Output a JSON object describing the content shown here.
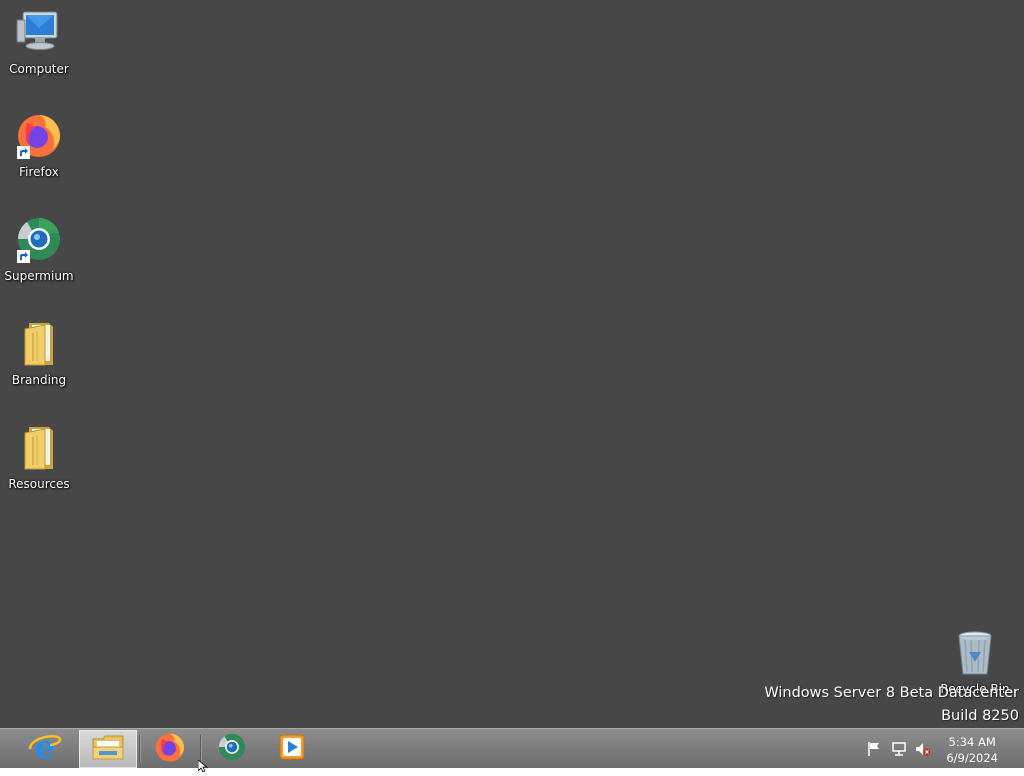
{
  "desktop": {
    "background_color": "#474747",
    "icons": [
      {
        "label": "Computer",
        "icon": "computer-icon"
      },
      {
        "label": "Firefox",
        "icon": "firefox-icon",
        "shortcut": true
      },
      {
        "label": "Supermium",
        "icon": "supermium-icon",
        "shortcut": true
      },
      {
        "label": "Branding",
        "icon": "folder-icon"
      },
      {
        "label": "Resources",
        "icon": "folder-icon"
      }
    ],
    "recycle_bin": {
      "label": "Recycle Bin",
      "icon": "recycle-bin-icon"
    },
    "watermark": {
      "line1": "Windows Server 8 Beta Datacenter",
      "line2": "Build 8250"
    }
  },
  "taskbar": {
    "pinned": [
      {
        "name": "Internet Explorer",
        "icon": "internet-explorer-icon"
      },
      {
        "name": "File Explorer",
        "icon": "file-explorer-icon",
        "active": true
      },
      {
        "name": "Firefox",
        "icon": "firefox-icon"
      },
      {
        "name": "Supermium",
        "icon": "supermium-icon"
      },
      {
        "name": "Media Player",
        "icon": "media-player-icon"
      }
    ],
    "tray": {
      "icons": [
        "action-center-flag-icon",
        "network-icon",
        "volume-muted-icon"
      ],
      "time": "5:34 AM",
      "date": "6/9/2024"
    }
  }
}
